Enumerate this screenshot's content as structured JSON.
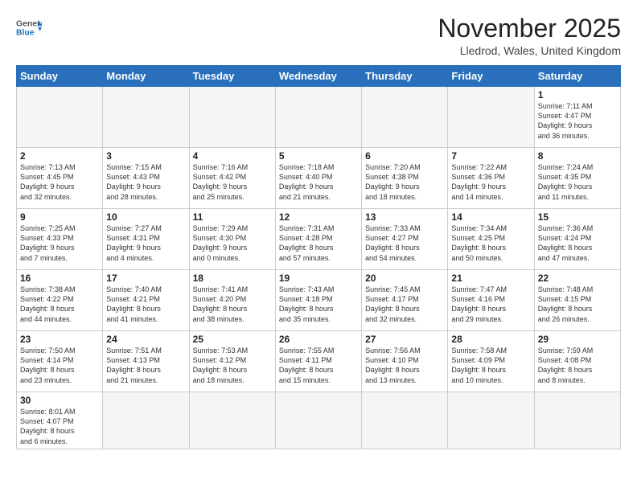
{
  "logo": {
    "general": "General",
    "blue": "Blue"
  },
  "header": {
    "month": "November 2025",
    "location": "Lledrod, Wales, United Kingdom"
  },
  "days_of_week": [
    "Sunday",
    "Monday",
    "Tuesday",
    "Wednesday",
    "Thursday",
    "Friday",
    "Saturday"
  ],
  "weeks": [
    [
      {
        "day": "",
        "info": ""
      },
      {
        "day": "",
        "info": ""
      },
      {
        "day": "",
        "info": ""
      },
      {
        "day": "",
        "info": ""
      },
      {
        "day": "",
        "info": ""
      },
      {
        "day": "",
        "info": ""
      },
      {
        "day": "1",
        "info": "Sunrise: 7:11 AM\nSunset: 4:47 PM\nDaylight: 9 hours\nand 36 minutes."
      }
    ],
    [
      {
        "day": "2",
        "info": "Sunrise: 7:13 AM\nSunset: 4:45 PM\nDaylight: 9 hours\nand 32 minutes."
      },
      {
        "day": "3",
        "info": "Sunrise: 7:15 AM\nSunset: 4:43 PM\nDaylight: 9 hours\nand 28 minutes."
      },
      {
        "day": "4",
        "info": "Sunrise: 7:16 AM\nSunset: 4:42 PM\nDaylight: 9 hours\nand 25 minutes."
      },
      {
        "day": "5",
        "info": "Sunrise: 7:18 AM\nSunset: 4:40 PM\nDaylight: 9 hours\nand 21 minutes."
      },
      {
        "day": "6",
        "info": "Sunrise: 7:20 AM\nSunset: 4:38 PM\nDaylight: 9 hours\nand 18 minutes."
      },
      {
        "day": "7",
        "info": "Sunrise: 7:22 AM\nSunset: 4:36 PM\nDaylight: 9 hours\nand 14 minutes."
      },
      {
        "day": "8",
        "info": "Sunrise: 7:24 AM\nSunset: 4:35 PM\nDaylight: 9 hours\nand 11 minutes."
      }
    ],
    [
      {
        "day": "9",
        "info": "Sunrise: 7:25 AM\nSunset: 4:33 PM\nDaylight: 9 hours\nand 7 minutes."
      },
      {
        "day": "10",
        "info": "Sunrise: 7:27 AM\nSunset: 4:31 PM\nDaylight: 9 hours\nand 4 minutes."
      },
      {
        "day": "11",
        "info": "Sunrise: 7:29 AM\nSunset: 4:30 PM\nDaylight: 9 hours\nand 0 minutes."
      },
      {
        "day": "12",
        "info": "Sunrise: 7:31 AM\nSunset: 4:28 PM\nDaylight: 8 hours\nand 57 minutes."
      },
      {
        "day": "13",
        "info": "Sunrise: 7:33 AM\nSunset: 4:27 PM\nDaylight: 8 hours\nand 54 minutes."
      },
      {
        "day": "14",
        "info": "Sunrise: 7:34 AM\nSunset: 4:25 PM\nDaylight: 8 hours\nand 50 minutes."
      },
      {
        "day": "15",
        "info": "Sunrise: 7:36 AM\nSunset: 4:24 PM\nDaylight: 8 hours\nand 47 minutes."
      }
    ],
    [
      {
        "day": "16",
        "info": "Sunrise: 7:38 AM\nSunset: 4:22 PM\nDaylight: 8 hours\nand 44 minutes."
      },
      {
        "day": "17",
        "info": "Sunrise: 7:40 AM\nSunset: 4:21 PM\nDaylight: 8 hours\nand 41 minutes."
      },
      {
        "day": "18",
        "info": "Sunrise: 7:41 AM\nSunset: 4:20 PM\nDaylight: 8 hours\nand 38 minutes."
      },
      {
        "day": "19",
        "info": "Sunrise: 7:43 AM\nSunset: 4:18 PM\nDaylight: 8 hours\nand 35 minutes."
      },
      {
        "day": "20",
        "info": "Sunrise: 7:45 AM\nSunset: 4:17 PM\nDaylight: 8 hours\nand 32 minutes."
      },
      {
        "day": "21",
        "info": "Sunrise: 7:47 AM\nSunset: 4:16 PM\nDaylight: 8 hours\nand 29 minutes."
      },
      {
        "day": "22",
        "info": "Sunrise: 7:48 AM\nSunset: 4:15 PM\nDaylight: 8 hours\nand 26 minutes."
      }
    ],
    [
      {
        "day": "23",
        "info": "Sunrise: 7:50 AM\nSunset: 4:14 PM\nDaylight: 8 hours\nand 23 minutes."
      },
      {
        "day": "24",
        "info": "Sunrise: 7:51 AM\nSunset: 4:13 PM\nDaylight: 8 hours\nand 21 minutes."
      },
      {
        "day": "25",
        "info": "Sunrise: 7:53 AM\nSunset: 4:12 PM\nDaylight: 8 hours\nand 18 minutes."
      },
      {
        "day": "26",
        "info": "Sunrise: 7:55 AM\nSunset: 4:11 PM\nDaylight: 8 hours\nand 15 minutes."
      },
      {
        "day": "27",
        "info": "Sunrise: 7:56 AM\nSunset: 4:10 PM\nDaylight: 8 hours\nand 13 minutes."
      },
      {
        "day": "28",
        "info": "Sunrise: 7:58 AM\nSunset: 4:09 PM\nDaylight: 8 hours\nand 10 minutes."
      },
      {
        "day": "29",
        "info": "Sunrise: 7:59 AM\nSunset: 4:08 PM\nDaylight: 8 hours\nand 8 minutes."
      }
    ],
    [
      {
        "day": "30",
        "info": "Sunrise: 8:01 AM\nSunset: 4:07 PM\nDaylight: 8 hours\nand 6 minutes."
      },
      {
        "day": "",
        "info": ""
      },
      {
        "day": "",
        "info": ""
      },
      {
        "day": "",
        "info": ""
      },
      {
        "day": "",
        "info": ""
      },
      {
        "day": "",
        "info": ""
      },
      {
        "day": "",
        "info": ""
      }
    ]
  ]
}
